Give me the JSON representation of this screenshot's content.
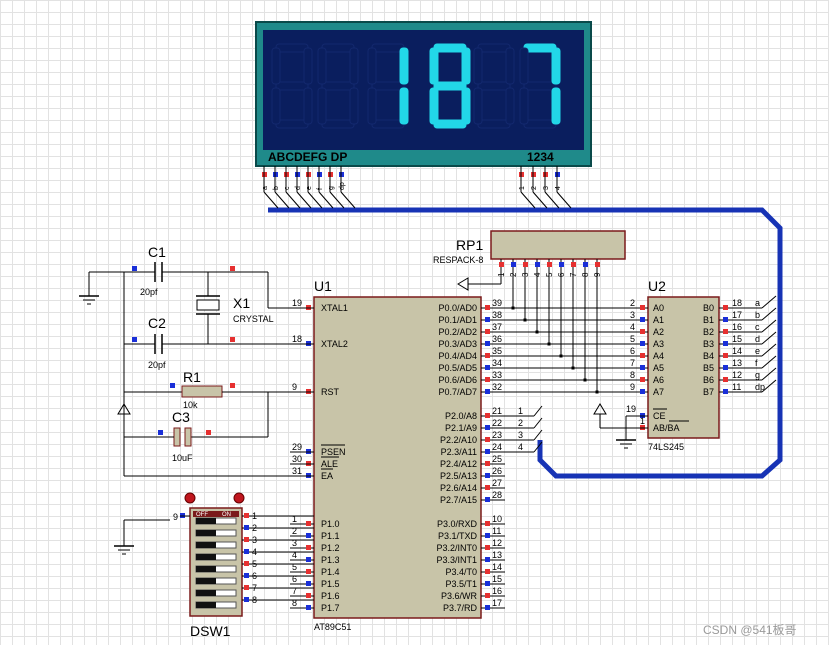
{
  "display": {
    "digits": [
      "",
      "",
      "1",
      "8",
      "",
      "7"
    ],
    "segment_label": "ABCDEFG DP",
    "digit_label": "1234",
    "seg_pins": [
      "a",
      "b",
      "c",
      "d",
      "e",
      "f",
      "g",
      "dp"
    ],
    "digit_pins": [
      "1",
      "2",
      "3",
      "4"
    ],
    "lit_color": "#22d7e8",
    "off_color": "#0a1e5e"
  },
  "rp1": {
    "ref": "RP1",
    "value": "RESPACK-8",
    "pins": [
      "1",
      "2",
      "3",
      "4",
      "5",
      "6",
      "7",
      "8",
      "9"
    ]
  },
  "u1": {
    "ref": "U1",
    "part": "AT89C51",
    "left_pins": [
      {
        "num": "19",
        "name": "XTAL1"
      },
      {
        "num": "18",
        "name": "XTAL2"
      },
      {
        "num": "9",
        "name": "RST"
      },
      {
        "num": "29",
        "name": "PSEN"
      },
      {
        "num": "30",
        "name": "ALE"
      },
      {
        "num": "31",
        "name": "EA"
      },
      {
        "num": "1",
        "name": "P1.0"
      },
      {
        "num": "2",
        "name": "P1.1"
      },
      {
        "num": "3",
        "name": "P1.2"
      },
      {
        "num": "4",
        "name": "P1.3"
      },
      {
        "num": "5",
        "name": "P1.4"
      },
      {
        "num": "6",
        "name": "P1.5"
      },
      {
        "num": "7",
        "name": "P1.6"
      },
      {
        "num": "8",
        "name": "P1.7"
      }
    ],
    "right_pins": [
      {
        "num": "39",
        "name": "P0.0/AD0"
      },
      {
        "num": "38",
        "name": "P0.1/AD1"
      },
      {
        "num": "37",
        "name": "P0.2/AD2"
      },
      {
        "num": "36",
        "name": "P0.3/AD3"
      },
      {
        "num": "35",
        "name": "P0.4/AD4"
      },
      {
        "num": "34",
        "name": "P0.5/AD5"
      },
      {
        "num": "33",
        "name": "P0.6/AD6"
      },
      {
        "num": "32",
        "name": "P0.7/AD7"
      },
      {
        "num": "21",
        "name": "P2.0/A8"
      },
      {
        "num": "22",
        "name": "P2.1/A9"
      },
      {
        "num": "23",
        "name": "P2.2/A10"
      },
      {
        "num": "24",
        "name": "P2.3/A11"
      },
      {
        "num": "25",
        "name": "P2.4/A12"
      },
      {
        "num": "26",
        "name": "P2.5/A13"
      },
      {
        "num": "27",
        "name": "P2.6/A14"
      },
      {
        "num": "28",
        "name": "P2.7/A15"
      },
      {
        "num": "10",
        "name": "P3.0/RXD"
      },
      {
        "num": "11",
        "name": "P3.1/TXD"
      },
      {
        "num": "12",
        "name": "P3.2/INT0"
      },
      {
        "num": "13",
        "name": "P3.3/INT1"
      },
      {
        "num": "14",
        "name": "P3.4/T0"
      },
      {
        "num": "15",
        "name": "P3.5/T1"
      },
      {
        "num": "16",
        "name": "P3.6/WR"
      },
      {
        "num": "17",
        "name": "P3.7/RD"
      }
    ],
    "p2_wire_labels": [
      "1",
      "2",
      "3",
      "4"
    ]
  },
  "u2": {
    "ref": "U2",
    "part": "74LS245",
    "a_pins": [
      {
        "num": "2",
        "name": "A0"
      },
      {
        "num": "3",
        "name": "A1"
      },
      {
        "num": "4",
        "name": "A2"
      },
      {
        "num": "5",
        "name": "A3"
      },
      {
        "num": "6",
        "name": "A4"
      },
      {
        "num": "7",
        "name": "A5"
      },
      {
        "num": "8",
        "name": "A6"
      },
      {
        "num": "9",
        "name": "A7"
      }
    ],
    "b_pins": [
      {
        "num": "18",
        "name": "B0",
        "net": "a"
      },
      {
        "num": "17",
        "name": "B1",
        "net": "b"
      },
      {
        "num": "16",
        "name": "B2",
        "net": "c"
      },
      {
        "num": "15",
        "name": "B3",
        "net": "d"
      },
      {
        "num": "14",
        "name": "B4",
        "net": "e"
      },
      {
        "num": "13",
        "name": "B5",
        "net": "f"
      },
      {
        "num": "12",
        "name": "B6",
        "net": "g"
      },
      {
        "num": "11",
        "name": "B7",
        "net": "dp"
      }
    ],
    "ce": {
      "num": "19",
      "name": "CE"
    },
    "abba": {
      "num": "1",
      "name": "AB/BA"
    }
  },
  "components": {
    "c1": {
      "ref": "C1",
      "value": "20pf"
    },
    "c2": {
      "ref": "C2",
      "value": "20pf"
    },
    "x1": {
      "ref": "X1",
      "value": "CRYSTAL"
    },
    "r1": {
      "ref": "R1",
      "value": "10k"
    },
    "c3": {
      "ref": "C3",
      "value": "10uF"
    }
  },
  "dsw1": {
    "ref": "DSW1",
    "off_label": "OFF",
    "on_label": "ON",
    "left_pins": [
      "1",
      "2",
      "3",
      "4",
      "5",
      "6",
      "7",
      "8"
    ],
    "common_pin": "9",
    "right_pins": [
      "1",
      "2",
      "3",
      "4",
      "5",
      "6",
      "7",
      "8"
    ]
  },
  "watermark": "CSDN @541板哥"
}
